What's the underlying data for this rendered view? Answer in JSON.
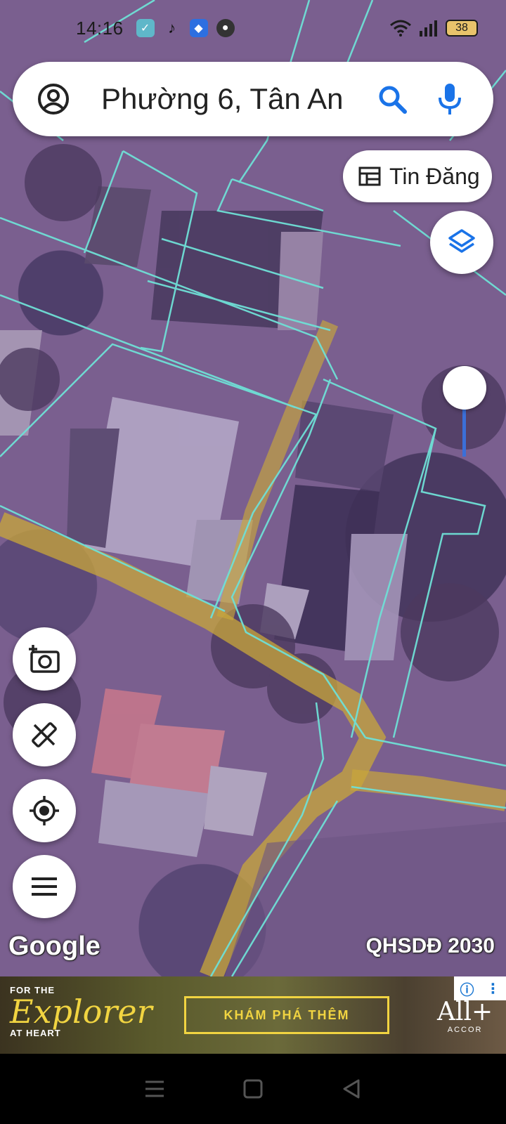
{
  "status_bar": {
    "time": "14:16",
    "battery": "38"
  },
  "search": {
    "text": "Phường 6, Tân An"
  },
  "chip": {
    "label": "Tin Đăng"
  },
  "map": {
    "attribution": "Google",
    "plan_label": "QHSDĐ 2030",
    "zoom_level": 0.25
  },
  "ad": {
    "line1": "FOR THE",
    "script": "Explorer",
    "line2": "AT HEART",
    "cta": "KHÁM PHÁ THÊM",
    "brand": "All+",
    "brand_sub": "ACCOR"
  },
  "colors": {
    "parcel_line": "#6fe0d6",
    "road_overlay": "#c9a73a",
    "accent_blue": "#1a73e8"
  },
  "icons": [
    "account-circle-icon",
    "search-icon",
    "microphone-icon",
    "calendar-table-icon",
    "layers-icon",
    "add-photo-icon",
    "measure-tool-icon",
    "my-location-icon",
    "menu-icon"
  ]
}
